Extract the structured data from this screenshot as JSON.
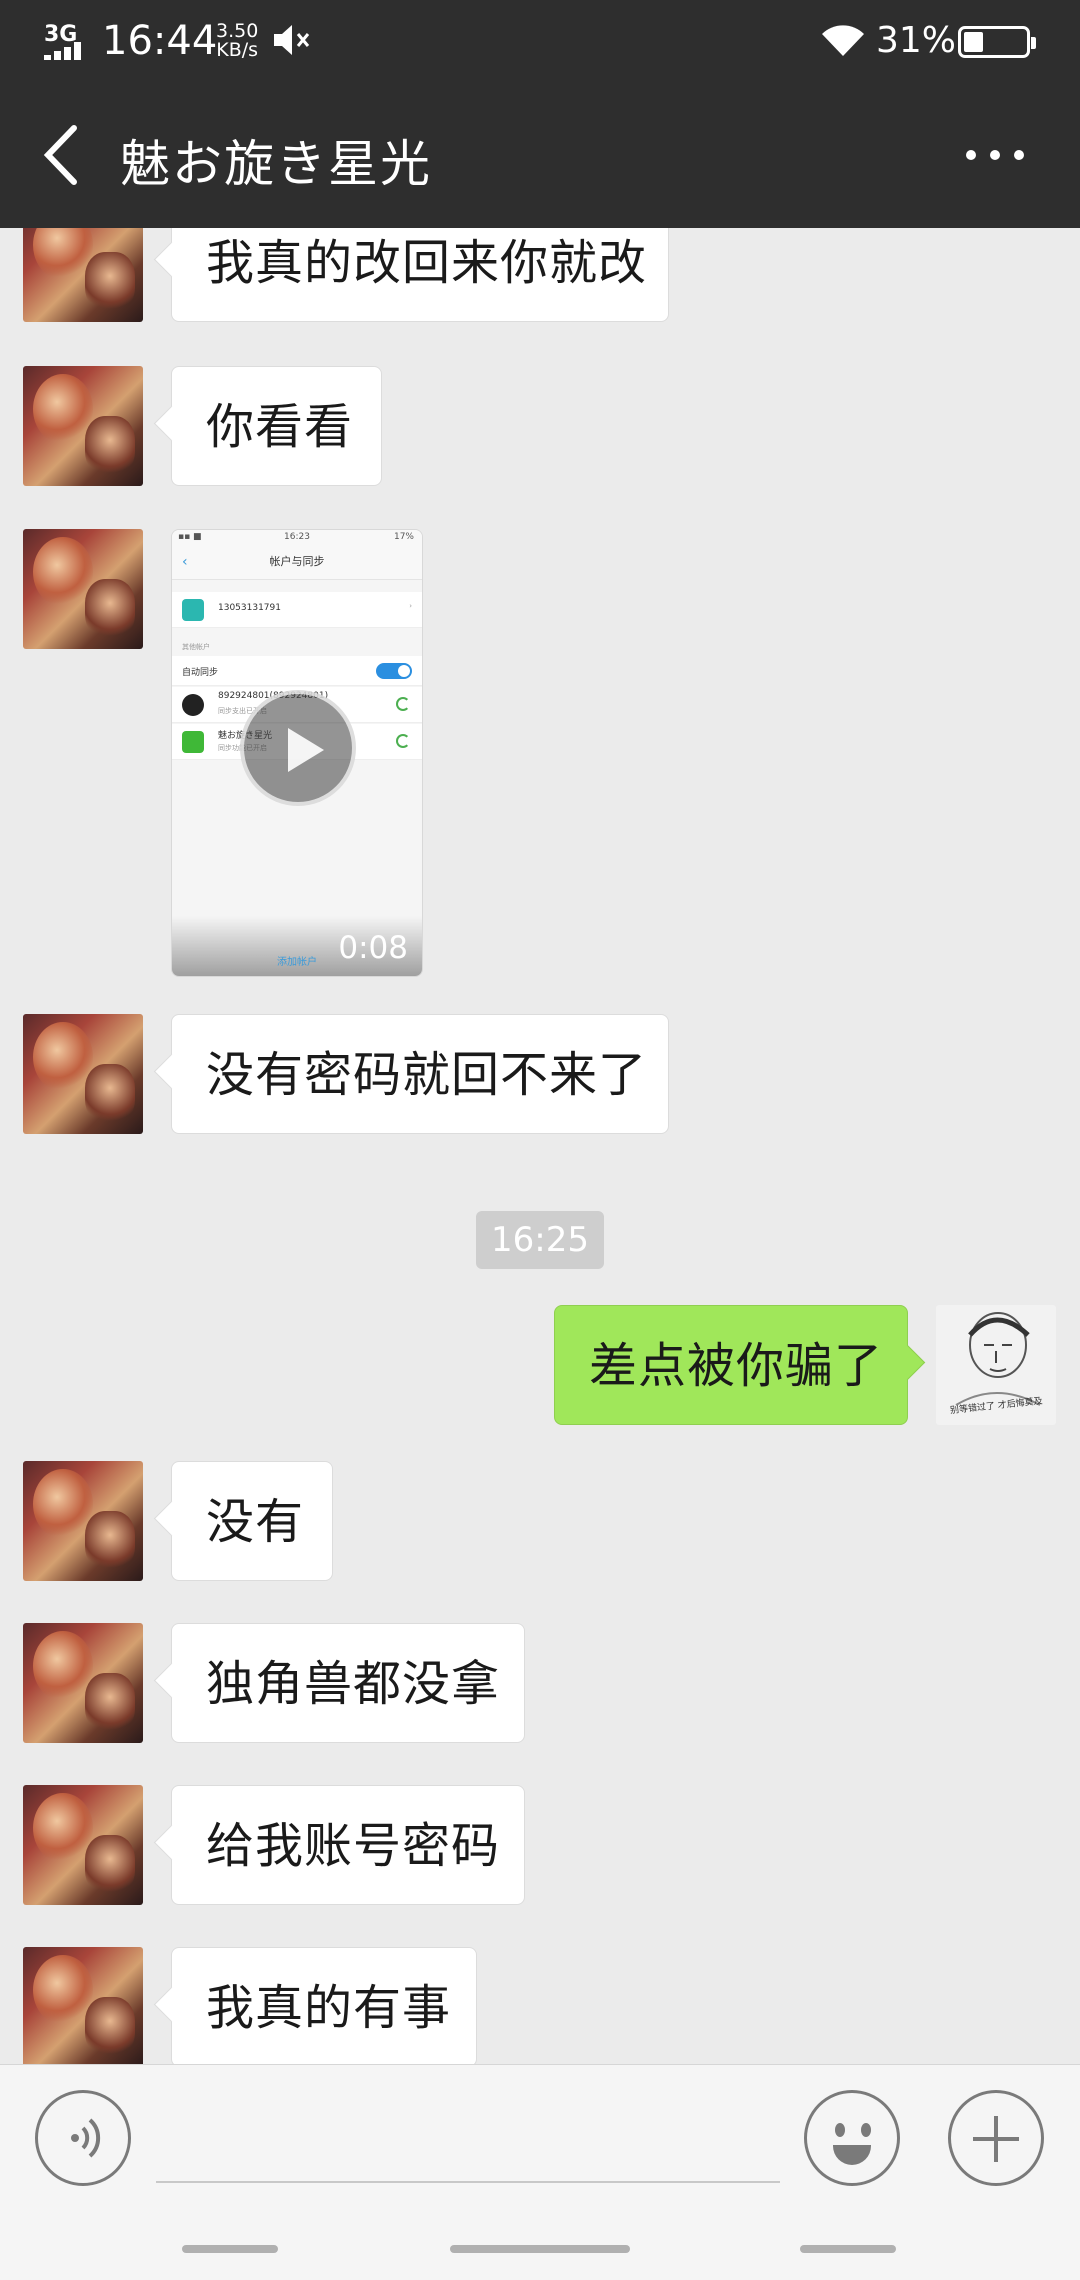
{
  "status_bar": {
    "network": "3G",
    "time": "16:44",
    "speed_value": "3.50",
    "speed_unit": "KB/s",
    "battery": "31%",
    "battery_level": 0.31
  },
  "header": {
    "title": "魅お旋き星光"
  },
  "messages": [
    {
      "from": "other",
      "text": "我真的改回来你就改"
    },
    {
      "from": "other",
      "text": "你看看"
    },
    {
      "from": "other",
      "type": "video",
      "duration": "0:08"
    },
    {
      "from": "other",
      "text": "没有密码就回不来了"
    },
    {
      "type": "timestamp",
      "text": "16:25"
    },
    {
      "from": "me",
      "text": "差点被你骗了"
    },
    {
      "from": "other",
      "text": "没有"
    },
    {
      "from": "other",
      "text": "独角兽都没拿"
    },
    {
      "from": "other",
      "text": "给我账号密码"
    },
    {
      "from": "other",
      "text": "我真的有事"
    }
  ],
  "video_thumb": {
    "time": "16:23",
    "battery": "17%",
    "header": "帐户与同步",
    "phone": "13053131791",
    "other_accounts": "其他帐户",
    "auto_sync": "自动同步",
    "qq_account": "892924801(892924801)",
    "qq_sub": "同步支出已开启",
    "wechat_account": "魅お旋き星光",
    "wechat_sub": "同步功能已开启",
    "add_account": "添加帐户"
  },
  "sent_avatar_caption": "别等错过了 才后悔莫及",
  "input": {
    "value": "",
    "placeholder": ""
  },
  "colors": {
    "header_bg": "#2e2e2e",
    "chat_bg": "#ebebeb",
    "sent_bubble": "#a0e75a",
    "received_bubble": "#ffffff"
  }
}
